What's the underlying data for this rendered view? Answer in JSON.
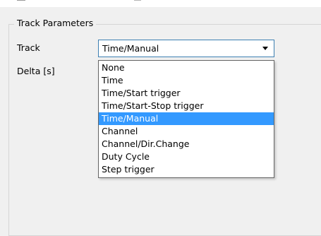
{
  "group": {
    "title": "Track Parameters"
  },
  "fields": {
    "track_label": "Track",
    "delta_label": "Delta [s]"
  },
  "combo": {
    "value": "Time/Manual",
    "options": [
      "None",
      "Time",
      "Time/Start trigger",
      "Time/Start-Stop trigger",
      "Time/Manual",
      "Channel",
      "Channel/Dir.Change",
      "Duty Cycle",
      "Step trigger"
    ],
    "selected_index": 4
  },
  "colors": {
    "selection": "#3399ff",
    "focus_border": "#3c7fb1"
  }
}
